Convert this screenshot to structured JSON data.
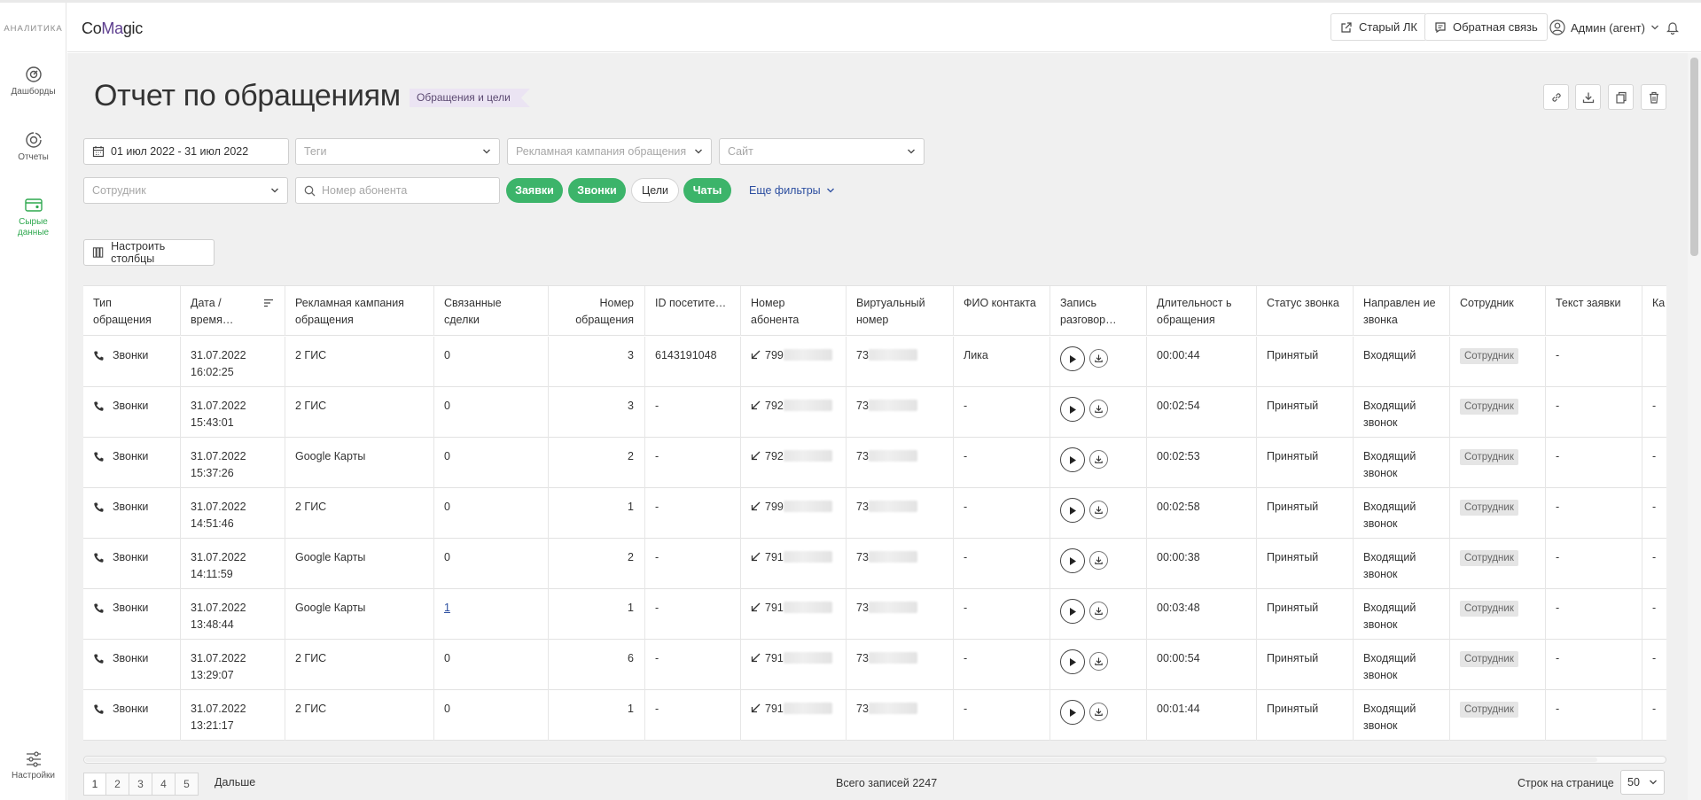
{
  "sidebar": {
    "title": "АНАЛИТИКА",
    "items": [
      {
        "label": "Дашборды",
        "icon": "dashboard-icon"
      },
      {
        "label": "Отчеты",
        "icon": "reports-icon"
      },
      {
        "label": "Сырые данные",
        "icon": "raw-data-icon",
        "active": true
      }
    ],
    "settings_label": "Настройки"
  },
  "header": {
    "logo": {
      "p1": "Co",
      "p2": "M",
      "p3": "a",
      "p4": "gic"
    },
    "old_lk": "Старый ЛК",
    "feedback": "Обратная связь",
    "user": "Админ (агент)"
  },
  "page": {
    "title": "Отчет по обращениям",
    "tag": "Обращения и цели"
  },
  "filters": {
    "date_range": "01 июл 2022 - 31 июл 2022",
    "tags_placeholder": "Теги",
    "campaign_placeholder": "Рекламная кампания обращения",
    "site_placeholder": "Сайт",
    "employee_placeholder": "Сотрудник",
    "phone_placeholder": "Номер абонента",
    "pills": [
      {
        "label": "Заявки",
        "active": true
      },
      {
        "label": "Звонки",
        "active": true
      },
      {
        "label": "Цели",
        "active": false
      },
      {
        "label": "Чаты",
        "active": true
      }
    ],
    "more_filters": "Еще фильтры",
    "columns_button": "Настроить столбцы"
  },
  "table": {
    "columns": [
      "Тип обращения",
      "Дата / время…",
      "Рекламная кампания обращения",
      "Связанные сделки",
      "Номер обращения",
      "ID посетите…",
      "Номер абонента",
      "Виртуальный номер",
      "ФИО контакта",
      "Запись разговор…",
      "Длительност ь обращения",
      "Статус звонка",
      "Направлен ие звонка",
      "Сотрудник",
      "Текст заявки",
      "Ка кл"
    ],
    "rows": [
      {
        "type": "Звонки",
        "date": "31.07.2022",
        "time": "16:02:25",
        "campaign": "2 ГИС",
        "deals": "0",
        "number": "3",
        "visitor": "6143191048",
        "caller": "799",
        "virtual": "73",
        "contact": "Лика",
        "duration": "00:00:44",
        "status": "Принятый",
        "dir1": "Входящий",
        "dir2": "",
        "employee": "Сотрудник",
        "text": "-",
        "extra": ""
      },
      {
        "type": "Звонки",
        "date": "31.07.2022",
        "time": "15:43:01",
        "campaign": "2 ГИС",
        "deals": "0",
        "number": "3",
        "visitor": "-",
        "caller": "792",
        "virtual": "73",
        "contact": "-",
        "duration": "00:02:54",
        "status": "Принятый",
        "dir1": "Входящий",
        "dir2": "звонок",
        "employee": "Сотрудник",
        "text": "-",
        "extra": "-"
      },
      {
        "type": "Звонки",
        "date": "31.07.2022",
        "time": "15:37:26",
        "campaign": "Google Карты",
        "deals": "0",
        "number": "2",
        "visitor": "-",
        "caller": "792",
        "virtual": "73",
        "contact": "-",
        "duration": "00:02:53",
        "status": "Принятый",
        "dir1": "Входящий",
        "dir2": "звонок",
        "employee": "Сотрудник",
        "text": "-",
        "extra": "-"
      },
      {
        "type": "Звонки",
        "date": "31.07.2022",
        "time": "14:51:46",
        "campaign": "2 ГИС",
        "deals": "0",
        "number": "1",
        "visitor": "-",
        "caller": "799",
        "virtual": "73",
        "contact": "-",
        "duration": "00:02:58",
        "status": "Принятый",
        "dir1": "Входящий",
        "dir2": "звонок",
        "employee": "Сотрудник",
        "text": "-",
        "extra": "-"
      },
      {
        "type": "Звонки",
        "date": "31.07.2022",
        "time": "14:11:59",
        "campaign": "Google Карты",
        "deals": "0",
        "number": "2",
        "visitor": "-",
        "caller": "791",
        "virtual": "73",
        "contact": "-",
        "duration": "00:00:38",
        "status": "Принятый",
        "dir1": "Входящий",
        "dir2": "звонок",
        "employee": "Сотрудник",
        "text": "-",
        "extra": "-"
      },
      {
        "type": "Звонки",
        "date": "31.07.2022",
        "time": "13:48:44",
        "campaign": "Google Карты",
        "deals": "1",
        "deals_link": true,
        "number": "1",
        "visitor": "-",
        "caller": "791",
        "virtual": "73",
        "contact": "-",
        "duration": "00:03:48",
        "status": "Принятый",
        "dir1": "Входящий",
        "dir2": "звонок",
        "employee": "Сотрудник",
        "text": "-",
        "extra": "-"
      },
      {
        "type": "Звонки",
        "date": "31.07.2022",
        "time": "13:29:07",
        "campaign": "2 ГИС",
        "deals": "0",
        "number": "6",
        "visitor": "-",
        "caller": "791",
        "virtual": "73",
        "contact": "-",
        "duration": "00:00:54",
        "status": "Принятый",
        "dir1": "Входящий",
        "dir2": "звонок",
        "employee": "Сотрудник",
        "text": "-",
        "extra": "-"
      },
      {
        "type": "Звонки",
        "date": "31.07.2022",
        "time": "13:21:17",
        "campaign": "2 ГИС",
        "deals": "0",
        "number": "1",
        "visitor": "-",
        "caller": "791",
        "virtual": "73",
        "contact": "-",
        "duration": "00:01:44",
        "status": "Принятый",
        "dir1": "Входящий",
        "dir2": "звонок",
        "employee": "Сотрудник",
        "text": "-",
        "extra": "-"
      }
    ]
  },
  "pagination": {
    "pages": [
      "1",
      "2",
      "3",
      "4",
      "5"
    ],
    "next": "Дальше",
    "total": "Всего записей 2247",
    "per_page_label": "Строк на странице",
    "per_page": "50"
  },
  "colors": {
    "accent_green": "#3cb46a",
    "brand_purple": "#5e3f8f",
    "link_blue": "#2c4ea0"
  }
}
